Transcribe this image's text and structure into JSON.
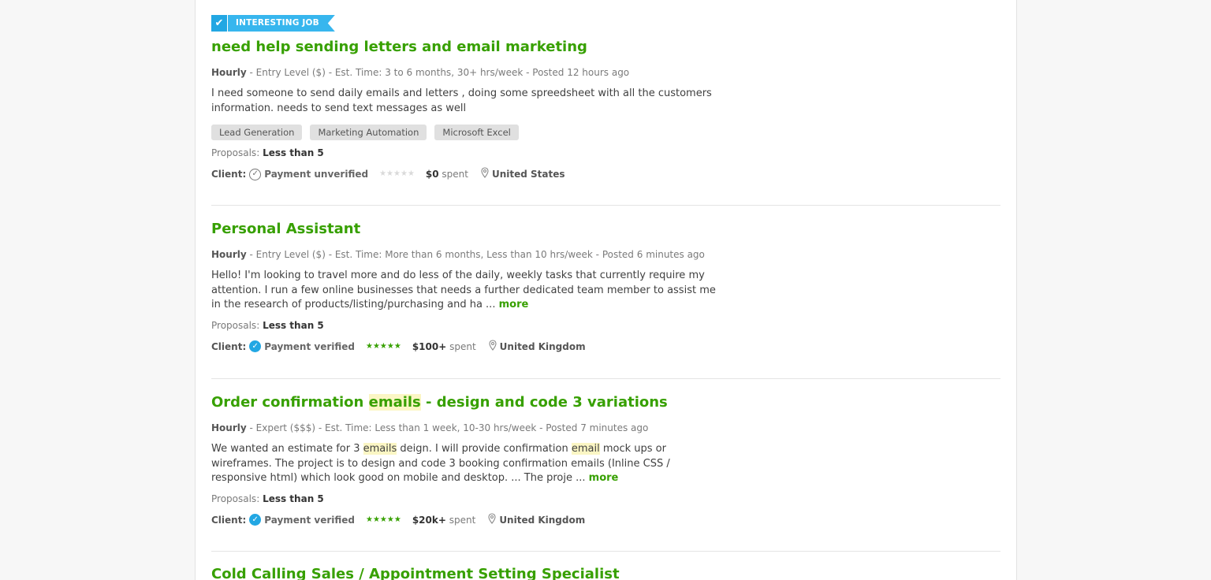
{
  "jobs": [
    {
      "badge": "INTERESTING JOB",
      "title": "need help sending letters and email marketing",
      "type": "Hourly",
      "meta": " - Entry Level ($) - Est. Time: 3 to 6 months, 30+ hrs/week - Posted 12 hours ago",
      "description": "I need someone to send daily emails and letters , doing some spreedsheet with all the customers information. needs to send text messages as well",
      "tags": [
        "Lead Generation",
        "Marketing Automation",
        "Microsoft Excel"
      ],
      "proposals_label": "Proposals:",
      "proposals_value": "Less than 5",
      "client_label": "Client:",
      "payment_status": "Payment unverified",
      "rating_stars": "★★★★★",
      "spent_amount": "$0",
      "spent_suffix": " spent",
      "country": "United States"
    },
    {
      "title": "Personal Assistant",
      "type": "Hourly",
      "meta": " - Entry Level ($) - Est. Time: More than 6 months, Less than 10 hrs/week - Posted 6 minutes ago",
      "description": "Hello! I'm looking to travel more and do less of the daily, weekly tasks that currently require my attention. I run a few online businesses that needs a further dedicated team member to assist me in the research of products/listing/purchasing and ha ... ",
      "more": "more",
      "proposals_label": "Proposals:",
      "proposals_value": "Less than 5",
      "client_label": "Client:",
      "payment_status": "Payment verified",
      "rating_stars": "★★★★★",
      "spent_amount": "$100+",
      "spent_suffix": " spent",
      "country": "United Kingdom"
    },
    {
      "title_pre": "Order confirmation ",
      "title_hl": "emails",
      "title_post": " - design and code 3 variations",
      "type": "Hourly",
      "meta": " - Expert ($$$) - Est. Time: Less than 1 week, 10-30 hrs/week - Posted 7 minutes ago",
      "desc_1": "We wanted an estimate for 3 ",
      "desc_hl1": "emails",
      "desc_2": " deign. I will provide confirmation ",
      "desc_hl2": "email",
      "desc_3": " mock ups or wireframes. The project is to design and code 3 booking confirmation emails (Inline CSS / responsive html) which look good on mobile and desktop. ... The proje ... ",
      "more": "more",
      "proposals_label": "Proposals:",
      "proposals_value": "Less than 5",
      "client_label": "Client:",
      "payment_status": "Payment verified",
      "rating_stars": "★★★★★",
      "spent_amount": "$20k+",
      "spent_suffix": " spent",
      "country": "United Kingdom"
    },
    {
      "title": "Cold Calling Sales / Appointment Setting Specialist"
    }
  ],
  "colors": {
    "title_green": "#37a000",
    "badge_blue": "#37b6ee",
    "verified_blue": "#22a7e3",
    "highlight": "#fbf6c4"
  },
  "icons": {
    "badge": "checkmark-icon",
    "unverified": "check-circle-outline-icon",
    "verified": "check-circle-filled-icon",
    "location": "map-pin-icon",
    "rating": "star-icon"
  }
}
